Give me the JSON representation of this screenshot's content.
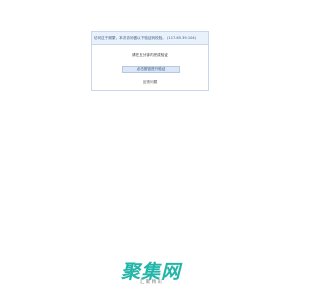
{
  "notice": {
    "header_text": "访问过于频繁，本次访问做以下验证码校验。 (117.65.39.104)",
    "prompt": "请在五分钟内完成验证",
    "captcha_button_label": "点击按钮进行验证",
    "help_link": "反馈问题"
  },
  "logo": {
    "text": "聚集网",
    "subtext": "汇 聚 精 彩",
    "color": "#23b6a8"
  }
}
